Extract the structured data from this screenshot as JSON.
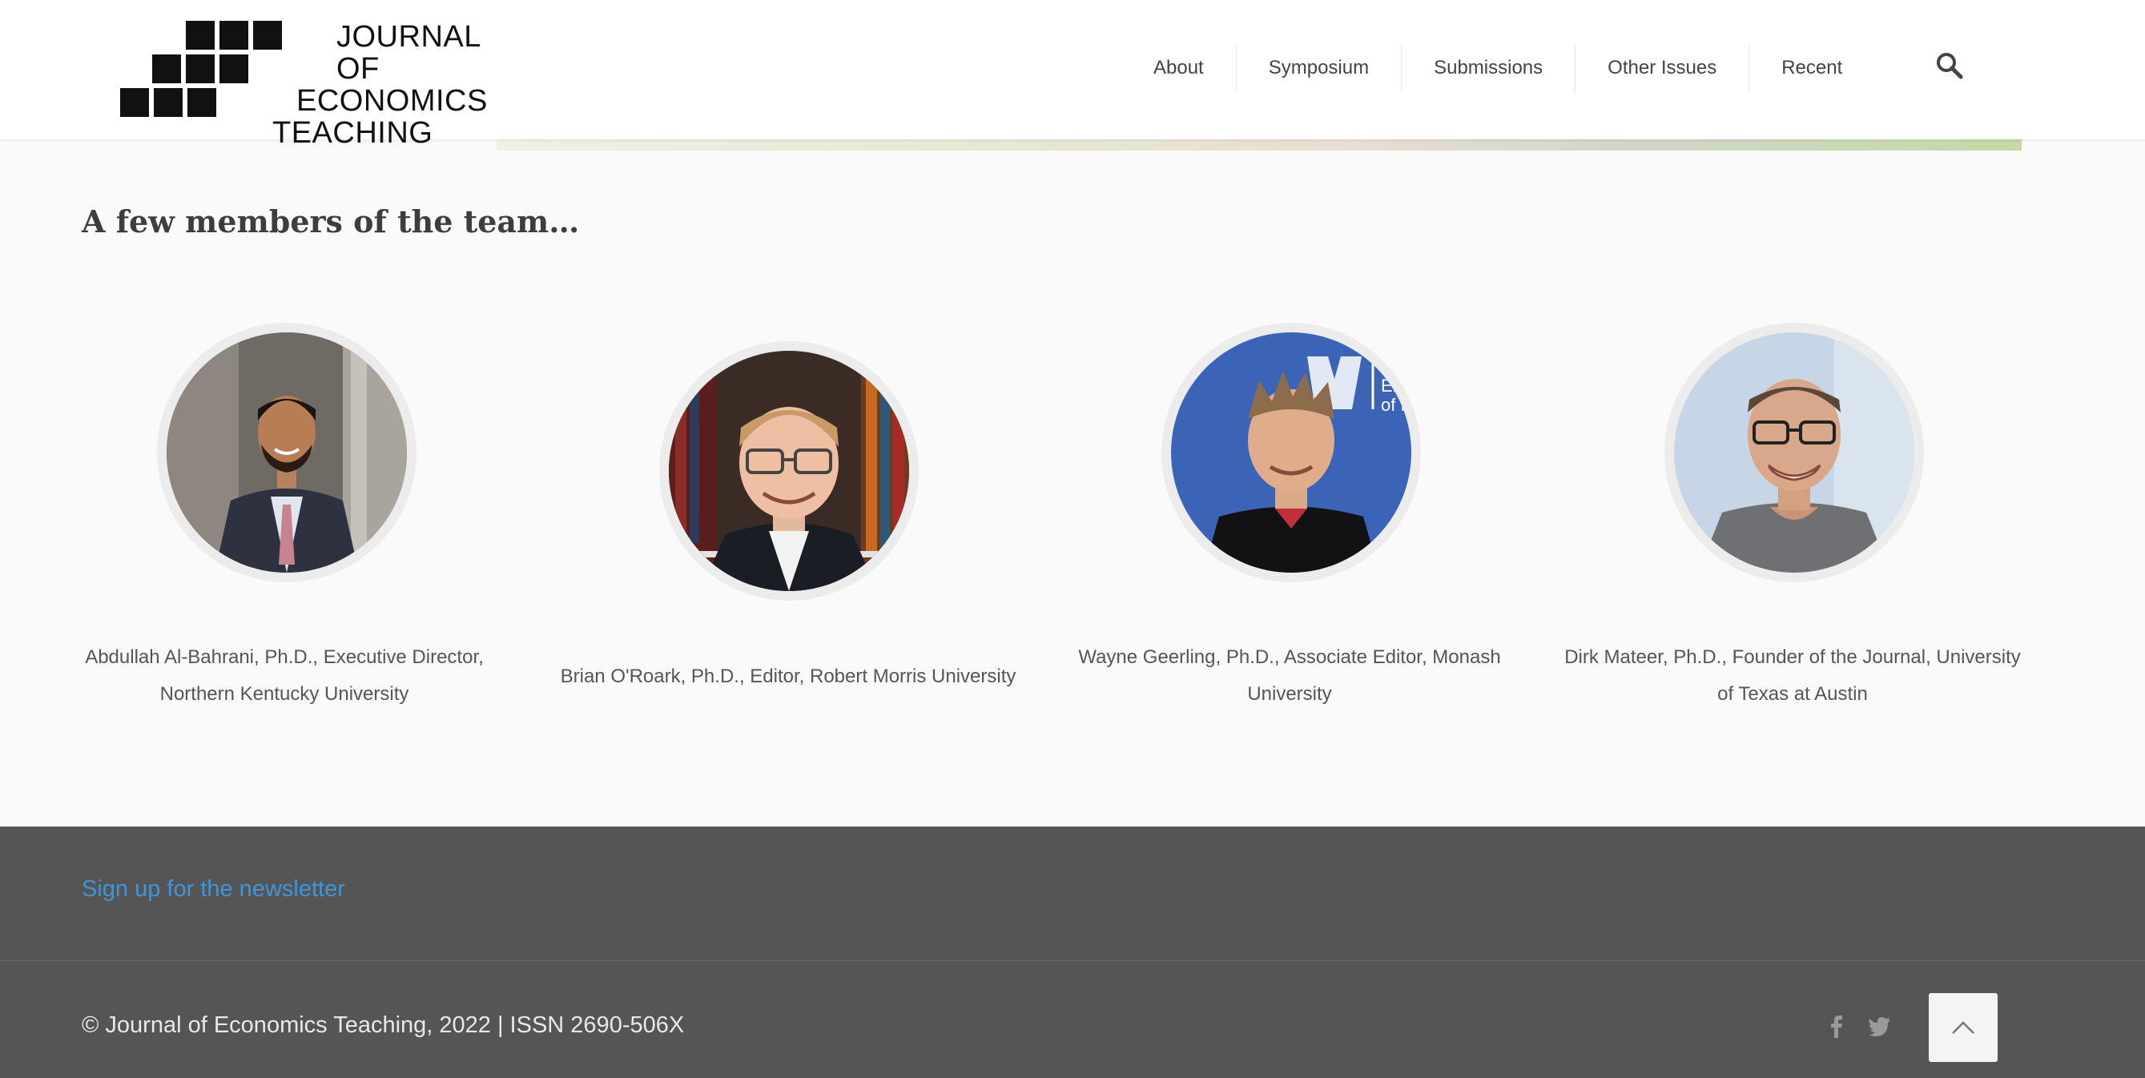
{
  "header": {
    "logo": {
      "line1": "JOURNAL OF",
      "line2": "ECONOMICS",
      "line3": "TEACHING"
    },
    "nav": [
      {
        "label": "About"
      },
      {
        "label": "Symposium"
      },
      {
        "label": "Submissions"
      },
      {
        "label": "Other Issues"
      },
      {
        "label": "Recent"
      }
    ]
  },
  "main": {
    "section_title": "A few members of the team…",
    "members": [
      {
        "caption": "Abdullah Al-Bahrani, Ph.D., Executive Director, Northern Kentucky University"
      },
      {
        "caption": "Brian O'Roark, Ph.D., Editor, Robert Morris University"
      },
      {
        "caption": "Wayne Geerling, Ph.D., Associate Editor, Monash University"
      },
      {
        "caption": "Dirk Mateer, Ph.D., Founder of the Journal, University of Texas at Austin"
      }
    ],
    "photo_sign_text": "THE U Eller of Ma"
  },
  "footer": {
    "newsletter_link": "Sign up for the newsletter",
    "copyright": "© Journal of Economics Teaching, 2022 | ISSN 2690-506X"
  },
  "colors": {
    "accent_link": "#3a97dc",
    "footer_bg": "#555555",
    "page_bg": "#fafafa"
  },
  "icons": [
    "search-icon",
    "facebook-icon",
    "twitter-icon",
    "chevron-up-icon"
  ]
}
